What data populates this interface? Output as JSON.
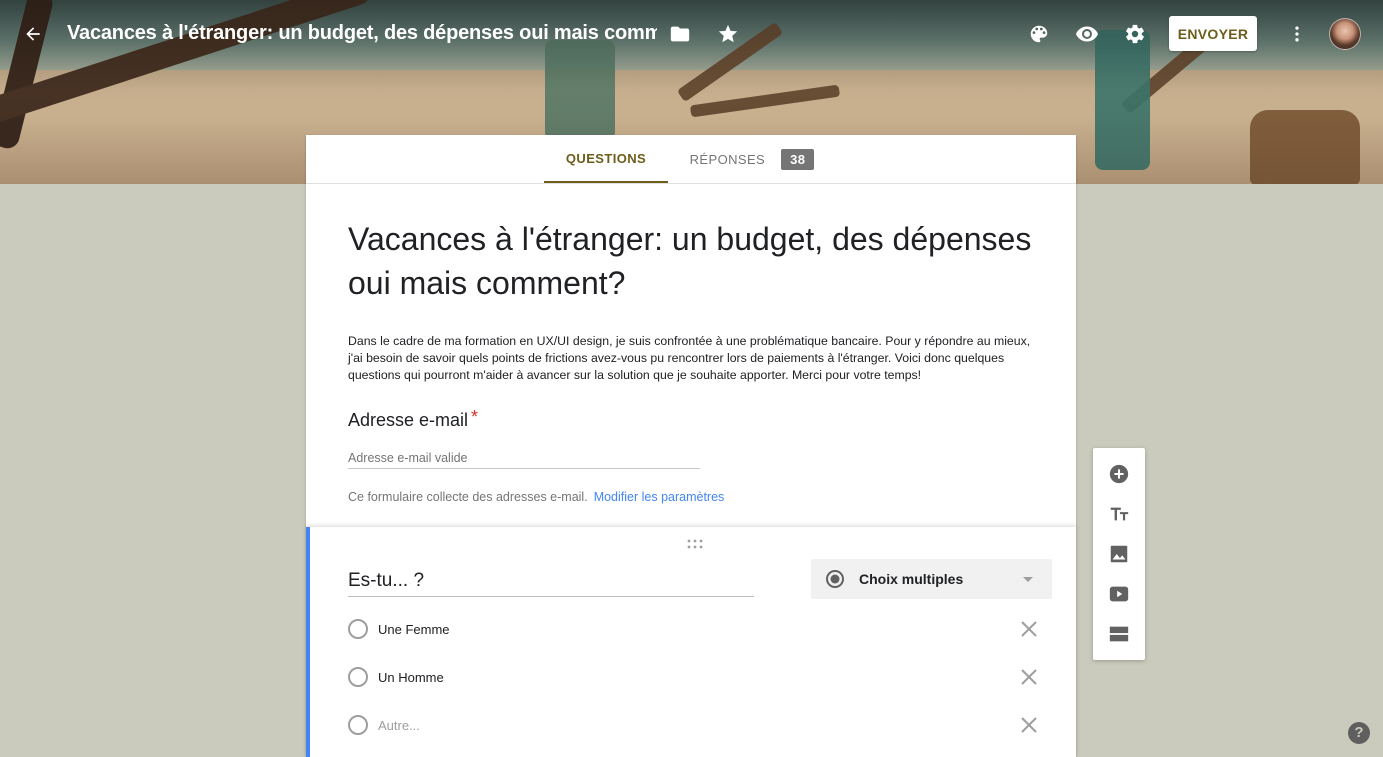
{
  "header": {
    "title": "Vacances à l'étranger: un budget, des dépenses oui mais commen",
    "send_label": "ENVOYER",
    "icons": [
      "back-arrow-icon",
      "folder-icon",
      "star-icon",
      "palette-icon",
      "eye-icon",
      "gear-icon",
      "more-vert-icon"
    ]
  },
  "tabs": {
    "questions": "QUESTIONS",
    "responses": "RÉPONSES",
    "responses_count": "38"
  },
  "form": {
    "title": "Vacances à l'étranger: un budget, des dépenses oui mais comment?",
    "description": "Dans le cadre de ma formation en UX/UI design, je suis confrontée à une problématique bancaire. Pour y répondre au mieux, j'ai besoin de savoir quels points de frictions avez-vous pu rencontrer lors de paiements à l'étranger. Voici donc quelques questions qui pourront m'aider à avancer sur la solution que je souhaite apporter. Merci pour votre temps!"
  },
  "email": {
    "label": "Adresse e-mail",
    "required_mark": "*",
    "placeholder": "Adresse e-mail valide",
    "note": "Ce formulaire collecte des adresses e-mail.",
    "settings_link": "Modifier les paramètres"
  },
  "question": {
    "title": "Es-tu... ?",
    "type_label": "Choix multiples",
    "options": [
      {
        "label": "Une Femme"
      },
      {
        "label": "Un Homme"
      },
      {
        "label": "Autre..."
      }
    ]
  },
  "side_toolbar": {
    "items": [
      "add-question-icon",
      "title-text-icon",
      "image-icon",
      "video-icon",
      "section-icon"
    ]
  },
  "help": {
    "label": "?"
  },
  "colors": {
    "accent": "#6d5d1a",
    "link": "#4285f4",
    "page_background": "#cbcbbd",
    "question_border": "#4285f4"
  }
}
